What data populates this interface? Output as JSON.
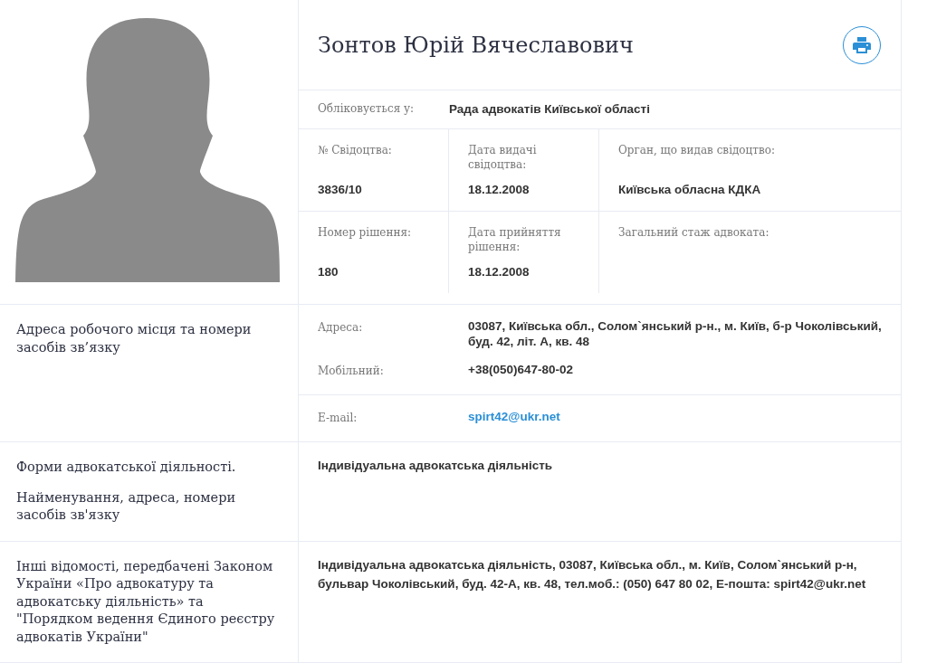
{
  "profile": {
    "name": "Зонтов Юрій Вячеславович"
  },
  "registration": {
    "label": "Обліковується у:",
    "value": "Рада адвокатів Київської області"
  },
  "certificate_rows": [
    {
      "cells": [
        {
          "label": "№ Свідоцтва:",
          "value": "3836/10"
        },
        {
          "label": "Дата видачі свідоцтва:",
          "value": "18.12.2008"
        },
        {
          "label": "Орган, що видав свідоцтво:",
          "value": "Київська обласна КДКА"
        }
      ]
    },
    {
      "cells": [
        {
          "label": "Номер рішення:",
          "value": "180"
        },
        {
          "label": "Дата прийняття рішення:",
          "value": "18.12.2008"
        },
        {
          "label": "Загальний стаж адвоката:"
        }
      ]
    }
  ],
  "sections": [
    {
      "kind": "contacts",
      "title": [
        "Адреса робочого місця та номери засобів зв’язку"
      ],
      "groups": [
        {
          "fields": [
            {
              "kind": "text",
              "label": "Адреса:",
              "value": "03087, Київська обл., Солом`янський р-н., м. Київ, б-р Чоколівський, буд. 42, літ. А, кв. 48"
            },
            {
              "kind": "text",
              "label": "Мобільний:",
              "value": "+38(050)647-80-02"
            }
          ]
        },
        {
          "fields": [
            {
              "kind": "link",
              "label": "E-mail:",
              "value": "spirt42@ukr.net"
            }
          ]
        }
      ]
    },
    {
      "kind": "text",
      "title": [
        "Форми адвокатської діяльності.",
        "Найменування, адреса, номери засобів зв'язку"
      ],
      "text": "Індивідуальна адвокатська діяльність"
    },
    {
      "kind": "text",
      "title": [
        "Інші відомості, передбачені Законом України «Про адвокатуру та адвокатську діяльність» та \"Порядком ведення Єдиного реєстру адвокатів України\""
      ],
      "text": "Індивідуальна адвокатська діяльність, 03087, Київська обл., м. Київ, Солом`янський р-н, бульвар Чоколівський, буд. 42-А, кв. 48, тел.моб.: (050) 647 80 02, E-пошта: spirt42@ukr.net"
    }
  ]
}
